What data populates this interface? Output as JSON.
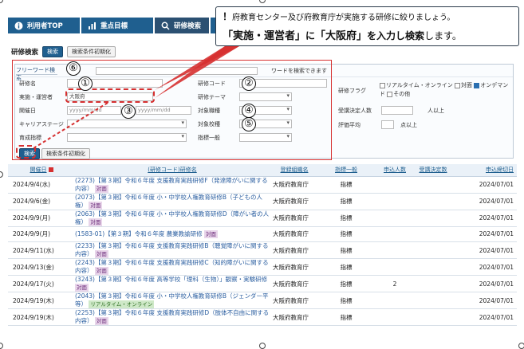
{
  "nav": [
    {
      "label": "利用者TOP",
      "icon": "info-icon"
    },
    {
      "label": "重点目標",
      "icon": "chart-icon"
    },
    {
      "label": "研修検索",
      "icon": "search-icon"
    }
  ],
  "subbar": {
    "title": "研修検索",
    "search_label": "検索",
    "reset_label": "検索条件初期化"
  },
  "freeword": {
    "label": "フリーワード検索",
    "hint": "ワードを検索できます"
  },
  "form": {
    "training_name": "研修名",
    "organizer": "実施・運営者",
    "organizer_value": "大阪府",
    "period": "開催日",
    "date_placeholder": "yyyy/mm/dd",
    "career_stage": "キャリアステージ",
    "indicator_type": "育成指標",
    "training_code": "研修コード",
    "training_theme": "研修テーマ",
    "target_job": "対象職種",
    "target_school": "対象校種",
    "indicator_general": "指標一般",
    "flag_label": "研修フラグ",
    "flag_opt1": "リアルタイム・オンライン",
    "flag_opt2": "対面",
    "flag_opt3": "オンデマンド",
    "flag_opt4": "その他",
    "decided_label": "受講決定人数",
    "decided_suffix": "人以上",
    "rating_label": "評価平均",
    "rating_suffix": "点以上",
    "search_label": "検索",
    "reset_label": "検索条件初期化",
    "tilde": "〜"
  },
  "markers": [
    "①",
    "②",
    "③",
    "④",
    "⑤",
    "⑥"
  ],
  "callout": {
    "line1_mark": "！",
    "line1": "府教育センター及び府教育庁が実施する研修に絞りましょう。",
    "line2_a": "「実施・運営者」",
    "line2_b": "に",
    "line2_c": "「大阪府」",
    "line2_d": "を入力し検索",
    "line2_e": "します。"
  },
  "table": {
    "headers": [
      "開催日",
      "(研修コード)研修名",
      "登録組織名",
      "指標一般",
      "申込人数",
      "受講決定数",
      "申込締切日"
    ],
    "rows": [
      {
        "date": "2024/9/4(水)",
        "code": "(2273)",
        "name": "【第３期】令和６年度 支援教育実践研修F（発達障がいに関する内容）",
        "tag": "対面",
        "tag2": "",
        "org": "大阪府教育庁",
        "ind": "指標",
        "app": "",
        "dt": "2024/07/01"
      },
      {
        "date": "2024/9/6(金)",
        "code": "(2073)",
        "name": "【第３期】令和６年度 小・中学校人権教育研修B（子どもの人権）",
        "tag": "対面",
        "tag2": "",
        "org": "大阪府教育庁",
        "ind": "指標",
        "app": "",
        "dt": "2024/07/01"
      },
      {
        "date": "2024/9/9(月)",
        "code": "(2063)",
        "name": "【第３期】令和６年度 小・中学校人権教育研修D（障がい者の人権）",
        "tag": "対面",
        "tag2": "",
        "org": "大阪府教育庁",
        "ind": "指標",
        "app": "",
        "dt": "2024/07/01"
      },
      {
        "date": "2024/9/9(月)",
        "code": "(1583-01)",
        "name": "【第３期】令和６年度 農業教諭研修",
        "tag": "対面",
        "tag2": "",
        "org": "大阪府教育庁",
        "ind": "指標",
        "app": "",
        "dt": "2024/07/01"
      },
      {
        "date": "2024/9/11(水)",
        "code": "(2233)",
        "name": "【第３期】令和６年度 支援教育実践研修B（聴覚障がいに関する内容）",
        "tag": "対面",
        "tag2": "",
        "org": "大阪府教育庁",
        "ind": "指標",
        "app": "",
        "dt": "2024/07/01"
      },
      {
        "date": "2024/9/13(金)",
        "code": "(2243)",
        "name": "【第３期】令和６年度 支援教育実践研修C（知的障がいに関する内容）",
        "tag": "対面",
        "tag2": "",
        "org": "大阪府教育庁",
        "ind": "指標",
        "app": "",
        "dt": "2024/07/01"
      },
      {
        "date": "2024/9/17(火)",
        "code": "(3243)",
        "name": "【第３期】令和６年度 高等学校「理科（生物）」観察・実験研修",
        "tag": "対面",
        "tag2": "",
        "org": "大阪府教育庁",
        "ind": "指標",
        "app": "2",
        "dt": "2024/07/01"
      },
      {
        "date": "2024/9/19(木)",
        "code": "(2043)",
        "name": "【第３期】令和６年度 小・中学校人権教育研修B（ジェンダー平等）",
        "tag": "",
        "tag2": "リアルタイム・オンライン",
        "org": "大阪府教育庁",
        "ind": "指標",
        "app": "",
        "dt": "2024/07/01"
      },
      {
        "date": "2024/9/19(木)",
        "code": "(2253)",
        "name": "【第３期】令和６年度 支援教育実践研修D（肢体不自由に関する内容）",
        "tag": "対面",
        "tag2": "",
        "org": "大阪府教育庁",
        "ind": "指標",
        "app": "",
        "dt": "2024/07/01"
      }
    ]
  },
  "colors": {
    "brand": "#1f5f8f",
    "annotation": "#d63030"
  }
}
